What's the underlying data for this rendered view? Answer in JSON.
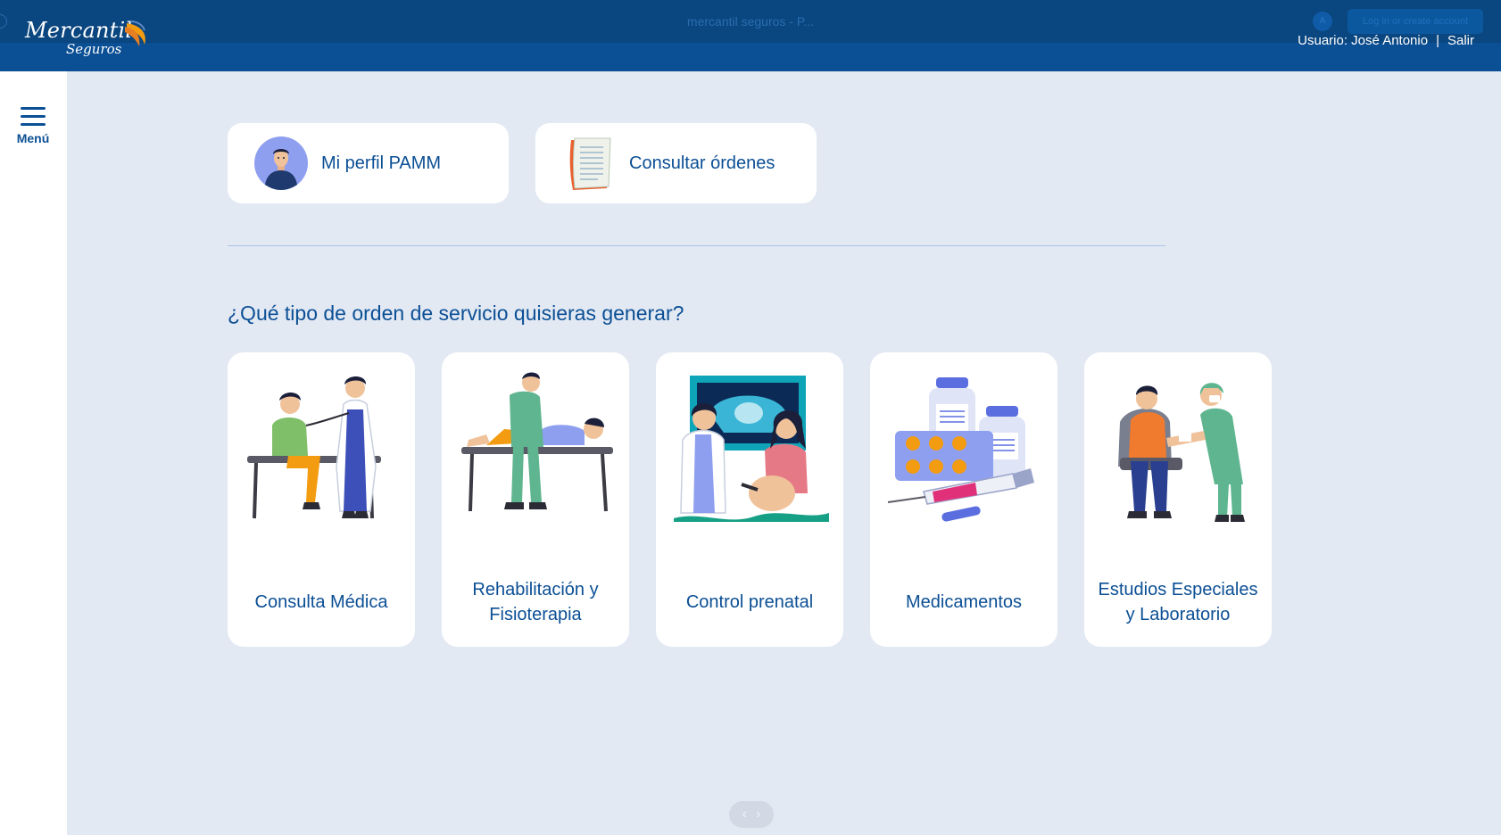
{
  "browser": {
    "title": "mercantil seguros - P...",
    "avatar_letter": "A",
    "login_label": "Log in or create account"
  },
  "header": {
    "logo_main": "Mercantil",
    "logo_sub": "Seguros",
    "user_label": "Usuario: José Antonio",
    "separator": "|",
    "logout_label": "Salir"
  },
  "sidebar": {
    "menu_label": "Menú"
  },
  "shortcuts": [
    {
      "label": "Mi perfil PAMM",
      "icon": "user-avatar-icon"
    },
    {
      "label": "Consultar órdenes",
      "icon": "document-list-icon"
    }
  ],
  "question": "¿Qué tipo de orden de servicio quisieras generar?",
  "services": [
    {
      "label": "Consulta Médica",
      "icon": "doctor-consultation-illustration"
    },
    {
      "label": "Rehabilitación y Fisioterapia",
      "icon": "physiotherapy-illustration"
    },
    {
      "label": "Control prenatal",
      "icon": "prenatal-ultrasound-illustration"
    },
    {
      "label": "Medicamentos",
      "icon": "medication-illustration"
    },
    {
      "label": "Estudios Especiales y Laboratorio",
      "icon": "lab-blood-test-illustration"
    }
  ],
  "pager": {
    "prev": "‹",
    "next": "›"
  },
  "colors": {
    "primary": "#0b4f95",
    "background": "#e3e9f3",
    "card": "#ffffff",
    "accent": "#f39c12"
  }
}
